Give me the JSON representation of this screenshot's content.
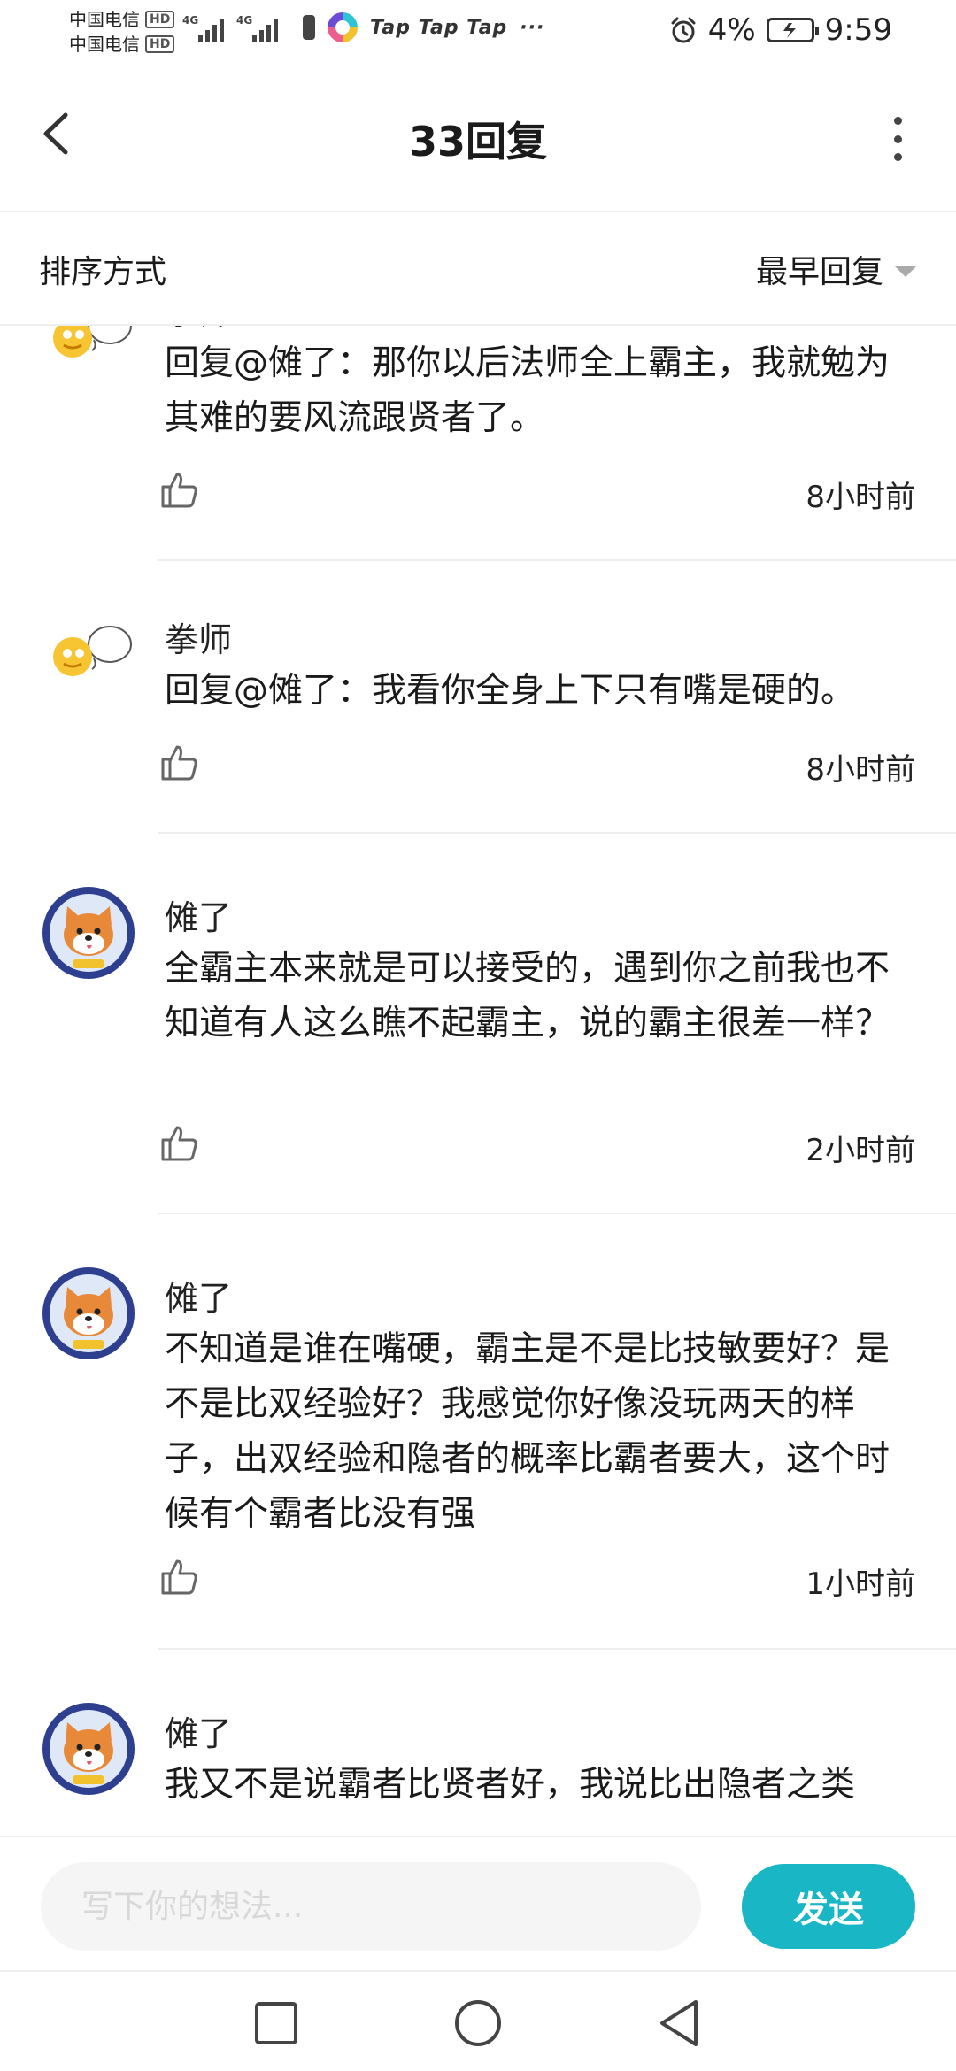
{
  "status_bar": {
    "carrier_1": "中国电信",
    "carrier_2": "中国电信",
    "hd": "HD",
    "net_1": "4G",
    "net_2": "4G",
    "tap_text": "Tap Tap Tap",
    "more": "···",
    "battery": "4%",
    "time": "9:59"
  },
  "header": {
    "title": "33回复"
  },
  "sort": {
    "label": "排序方式",
    "selected": "最早回复"
  },
  "comments": [
    {
      "author": "拳师",
      "text": "回复@傩了：那你以后法师全上霸主，我就勉为其难的要风流跟贤者了。",
      "time": "8小时前",
      "avatar": "smiley-avatar"
    },
    {
      "author": "拳师",
      "text": "回复@傩了：我看你全身上下只有嘴是硬的。",
      "time": "8小时前",
      "avatar": "smiley-avatar"
    },
    {
      "author": "傩了",
      "text": "全霸主本来就是可以接受的，遇到你之前我也不知道有人这么瞧不起霸主，说的霸主很差一样？",
      "time": "2小时前",
      "avatar": "shiba-avatar"
    },
    {
      "author": "傩了",
      "text": "不知道是谁在嘴硬，霸主是不是比技敏要好？是不是比双经验好？我感觉你好像没玩两天的样子，出双经验和隐者的概率比霸者要大，这个时候有个霸者比没有强",
      "time": "1小时前",
      "avatar": "shiba-avatar"
    },
    {
      "author": "傩了",
      "text": "我又不是说霸者比贤者好，我说比出隐者之类",
      "time": "",
      "avatar": "shiba-avatar"
    }
  ],
  "input": {
    "placeholder": "写下你的想法..."
  },
  "send": {
    "label": "发送"
  },
  "colors": {
    "accent": "#19b6c5",
    "divider": "#eeeeee",
    "text": "#1a1a1a"
  }
}
